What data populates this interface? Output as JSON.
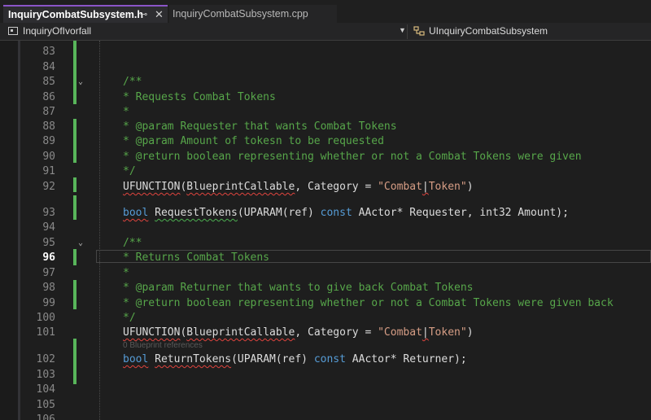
{
  "tabs": [
    {
      "label": "InquiryCombatSubsystem.h",
      "active": true
    },
    {
      "label": "InquiryCombatSubsystem.cpp",
      "active": false
    }
  ],
  "tab_pin_glyph": "⊸",
  "tab_close_glyph": "✕",
  "nav": {
    "project": "InquiryOfIvorfall",
    "scope": "UInquiryCombatSubsystem"
  },
  "lines": [
    {
      "n": "83"
    },
    {
      "n": "84"
    },
    {
      "n": "85"
    },
    {
      "n": "86"
    },
    {
      "n": "87"
    },
    {
      "n": "88"
    },
    {
      "n": "89"
    },
    {
      "n": "90"
    },
    {
      "n": "91"
    },
    {
      "n": "92"
    },
    {
      "n": "93"
    },
    {
      "n": "94"
    },
    {
      "n": "95"
    },
    {
      "n": "96"
    },
    {
      "n": "97"
    },
    {
      "n": "98"
    },
    {
      "n": "99"
    },
    {
      "n": "100"
    },
    {
      "n": "101"
    },
    {
      "n": "102"
    },
    {
      "n": "103"
    },
    {
      "n": "104"
    },
    {
      "n": "105"
    },
    {
      "n": "106"
    }
  ],
  "code": {
    "c85": "/**",
    "c86": "* Requests Combat Tokens",
    "c87": "*",
    "c88": "* @param Requester that wants Combat Tokens",
    "c89": "* @param Amount of tokesn to be requested",
    "c90": "* @return boolean representing whether or not a Combat Tokens were given",
    "c91": "*/",
    "uf": "UFUNCTION",
    "bpc": "BlueprintCallable",
    "category": "Category",
    "eq": " = ",
    "str1": "\"Combat",
    "bar": "|",
    "str2": "Token\"",
    "comma": ", ",
    "popen": "(",
    "pclose": ")",
    "bool": "bool",
    "req_fn": "RequestTokens",
    "uparam": "UPARAM",
    "ref": "(ref) ",
    "const": "const",
    "aactor": " AActor* ",
    "requester": "Requester, ",
    "int32": "int32",
    "amount": " Amount);",
    "c95": "/**",
    "c96": "* Returns Combat Tokens",
    "c97": "*",
    "c98": "* @param Returner that wants to give back Combat Tokens",
    "c99": "* @return boolean representing whether or not a Combat Tokens were given back",
    "c100": "*/",
    "ret_fn": "ReturnTokens",
    "returner": "Returner);",
    "hint": "0 Blueprint references"
  },
  "colors": {
    "comment": "#57a64a",
    "keyword": "#569cd6",
    "string": "#d69d85",
    "change_bar": "#58b55a",
    "active_tab_accent": "#8b55c7"
  }
}
